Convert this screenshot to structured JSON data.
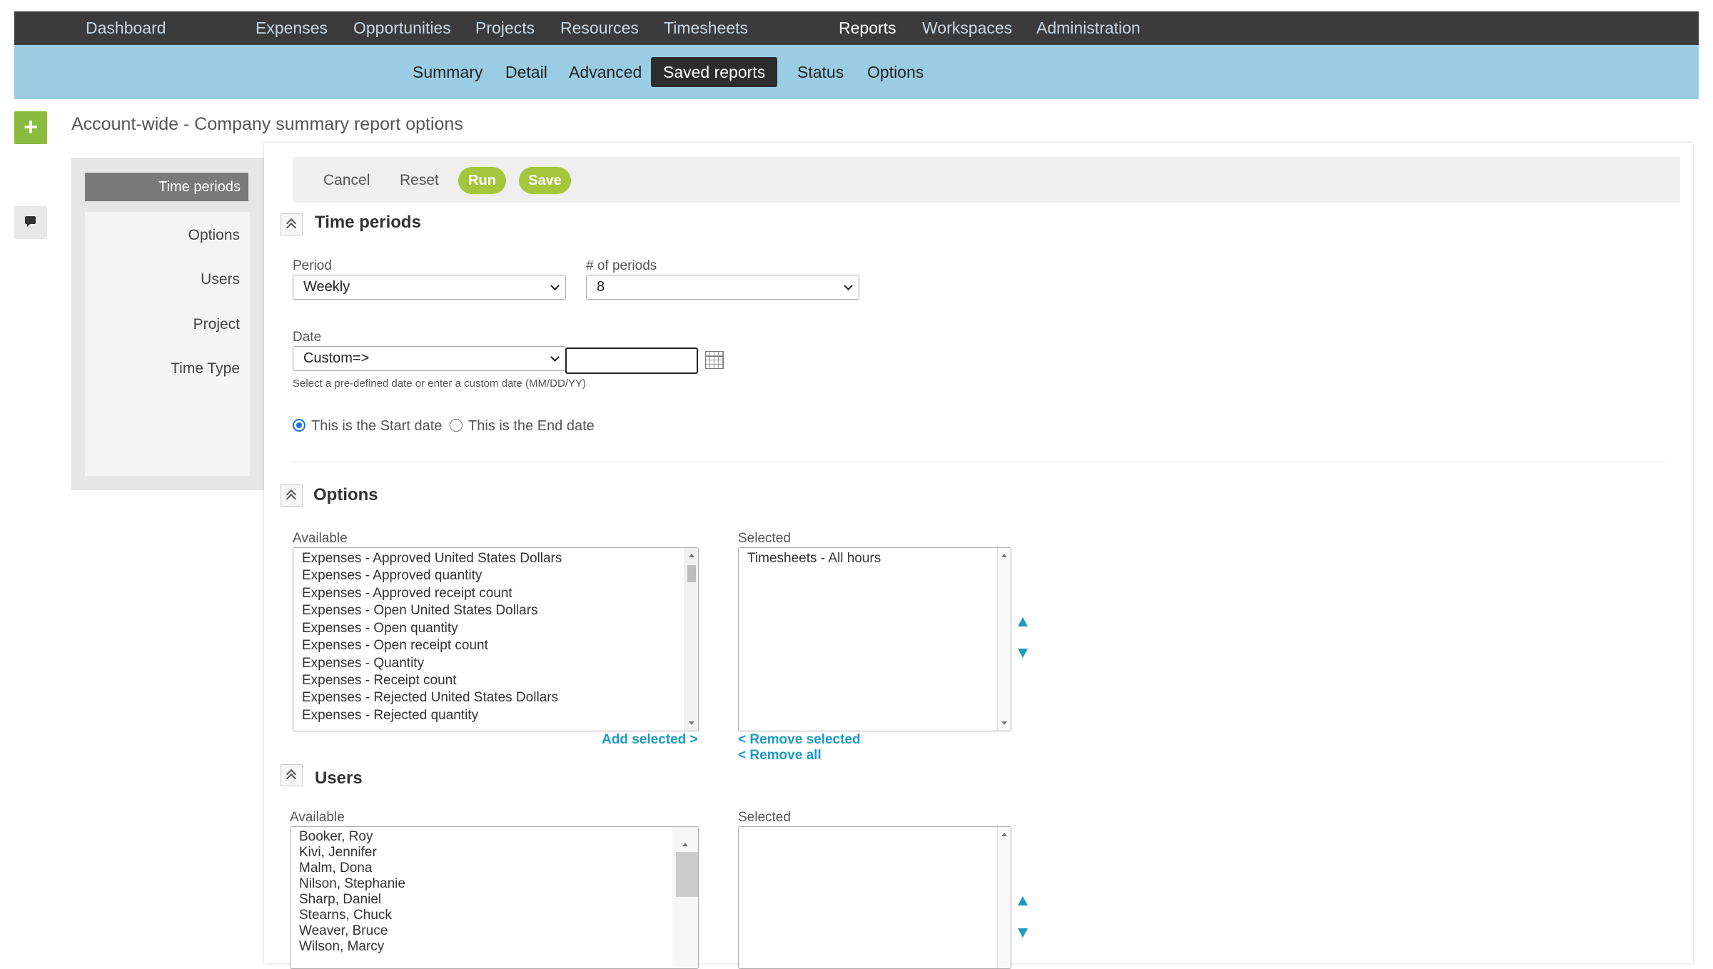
{
  "top_nav": {
    "items": [
      "Dashboard",
      "Expenses",
      "Opportunities",
      "Projects",
      "Resources",
      "Timesheets",
      "Reports",
      "Workspaces",
      "Administration"
    ],
    "active": "Reports"
  },
  "sub_nav": {
    "items": [
      "Summary",
      "Detail",
      "Advanced",
      "Saved reports",
      "Status",
      "Options"
    ],
    "active": "Saved reports"
  },
  "left_rail": {
    "add_icon": "+",
    "chat_icon": "chat-icon"
  },
  "page": {
    "title": "Account-wide - Company summary report options"
  },
  "side_tabs": {
    "active": "Time periods",
    "items": [
      "Options",
      "Users",
      "Project",
      "Time Type"
    ]
  },
  "toolbar": {
    "cancel": "Cancel",
    "reset": "Reset",
    "run": "Run",
    "save": "Save"
  },
  "time_periods": {
    "title": "Time periods",
    "period_label": "Period",
    "period_value": "Weekly",
    "num_periods_label": "# of periods",
    "num_periods_value": "8",
    "date_label": "Date",
    "date_value": "Custom=>",
    "date_custom_value": "",
    "date_hint": "Select a pre-defined date or enter a custom date (MM/DD/YY)",
    "radio_start": "This is the Start date",
    "radio_end": "This is the End date",
    "selected_radio": "start"
  },
  "options": {
    "title": "Options",
    "available_label": "Available",
    "selected_label": "Selected",
    "available": [
      "Expenses - Approved United States Dollars",
      "Expenses - Approved quantity",
      "Expenses - Approved receipt count",
      "Expenses - Open United States Dollars",
      "Expenses - Open quantity",
      "Expenses - Open receipt count",
      "Expenses - Quantity",
      "Expenses - Receipt count",
      "Expenses - Rejected United States Dollars",
      "Expenses - Rejected quantity"
    ],
    "selected": [
      "Timesheets - All hours"
    ],
    "add_selected": "Add selected >",
    "remove_selected": "< Remove selected",
    "remove_all": "< Remove all"
  },
  "users": {
    "title": "Users",
    "available_label": "Available",
    "selected_label": "Selected",
    "available": [
      "Booker, Roy",
      "Kivi, Jennifer",
      "Malm, Dona",
      "Nilson, Stephanie",
      "Sharp, Daniel",
      "Stearns, Chuck",
      "Weaver, Bruce",
      "Wilson, Marcy"
    ],
    "selected": []
  },
  "colors": {
    "accent_green": "#a3c63c",
    "subnav_blue": "#9acde4",
    "link_blue": "#1e9bc3",
    "topnav_bg": "#3b3b3b"
  }
}
